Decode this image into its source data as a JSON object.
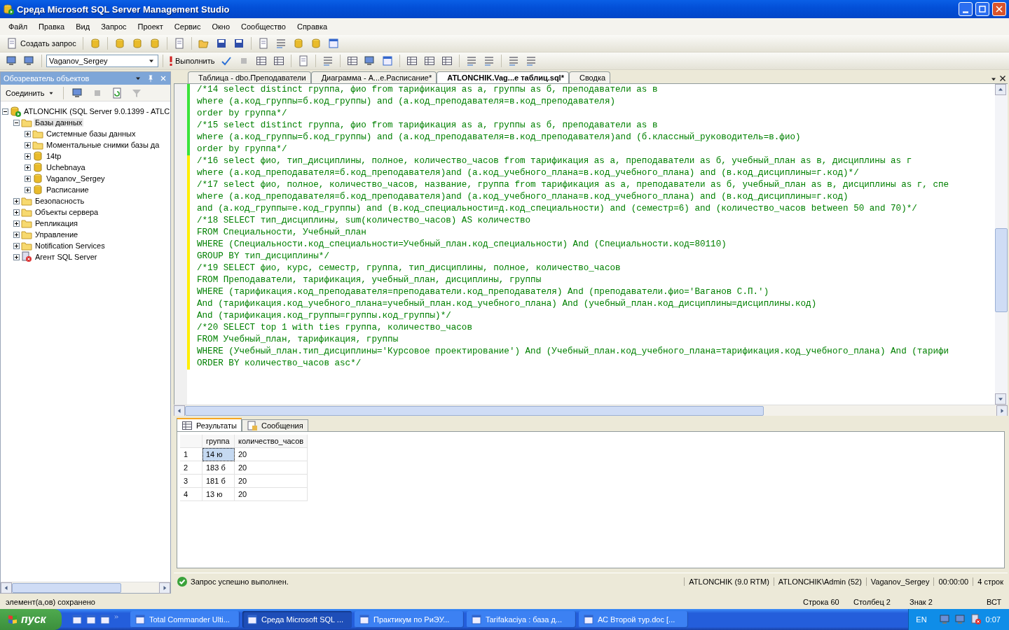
{
  "window": {
    "title": "Среда Microsoft SQL Server Management Studio"
  },
  "menu": [
    "Файл",
    "Правка",
    "Вид",
    "Запрос",
    "Проект",
    "Сервис",
    "Окно",
    "Сообщество",
    "Справка"
  ],
  "toolbar": {
    "new_query": "Создать запрос",
    "database": "Vaganov_Sergey",
    "execute": "Выполнить"
  },
  "object_explorer": {
    "title": "Обозреватель объектов",
    "connect": "Соединить",
    "tree": [
      {
        "label": "ATLONCHIK (SQL Server 9.0.1399 - ATLC",
        "kind": "server",
        "expanded": true,
        "selected": false,
        "children": [
          {
            "label": "Базы данных",
            "kind": "folder",
            "expanded": true,
            "selected": true,
            "children": [
              {
                "label": "Системные базы данных",
                "kind": "folder",
                "expanded": false,
                "selected": false
              },
              {
                "label": "Моментальные снимки базы да",
                "kind": "folder",
                "expanded": false,
                "selected": false
              },
              {
                "label": "14tp",
                "kind": "database",
                "expanded": false,
                "selected": false
              },
              {
                "label": "Uchebnaya",
                "kind": "database",
                "expanded": false,
                "selected": false
              },
              {
                "label": "Vaganov_Sergey",
                "kind": "database",
                "expanded": false,
                "selected": false
              },
              {
                "label": "Расписание",
                "kind": "database",
                "expanded": false,
                "selected": false
              }
            ]
          },
          {
            "label": "Безопасность",
            "kind": "folder",
            "expanded": false,
            "selected": false
          },
          {
            "label": "Объекты сервера",
            "kind": "folder",
            "expanded": false,
            "selected": false
          },
          {
            "label": "Репликация",
            "kind": "folder",
            "expanded": false,
            "selected": false
          },
          {
            "label": "Управление",
            "kind": "folder",
            "expanded": false,
            "selected": false
          },
          {
            "label": "Notification Services",
            "kind": "folder",
            "expanded": false,
            "selected": false
          },
          {
            "label": "Агент SQL Server",
            "kind": "agent",
            "expanded": false,
            "selected": false
          }
        ]
      }
    ]
  },
  "document_tabs": [
    {
      "label": "Таблица - dbo.Преподаватели",
      "selected": false
    },
    {
      "label": "Диаграмма - A...е.Расписание*",
      "selected": false
    },
    {
      "label": "ATLONCHIK.Vag...е таблиц.sql*",
      "selected": true
    },
    {
      "label": "Сводка",
      "selected": false
    }
  ],
  "editor": {
    "lines": [
      {
        "text": "/*14 select distinct группа, фио from тарификация as a, группы as б, преподаватели as в",
        "changed": false
      },
      {
        "text": "where (a.код_группы=б.код_группы) and (a.код_преподавателя=в.код_преподавателя)",
        "changed": false
      },
      {
        "text": "order by группа*/",
        "changed": false
      },
      {
        "text": "/*15 select distinct группа, фио from тарификация as a, группы as б, преподаватели as в",
        "changed": false
      },
      {
        "text": "where (a.код_группы=б.код_группы) and (a.код_преподавателя=в.код_преподавателя)and (б.классный_руководитель=в.фио)",
        "changed": false
      },
      {
        "text": "order by группа*/",
        "changed": false
      },
      {
        "text": "/*16 select фио, тип_дисциплины, полное, количество_часов from тарификация as a, преподаватели as б, учебный_план as в, дисциплины as г",
        "changed": true
      },
      {
        "text": "where (a.код_преподавателя=б.код_преподавателя)and (a.код_учебного_плана=в.код_учебного_плана) and (в.код_дисциплины=г.код)*/",
        "changed": true
      },
      {
        "text": "/*17 select фио, полное, количество_часов, название, группа from тарификация as a, преподаватели as б, учебный_план as в, дисциплины as г, спе",
        "changed": true
      },
      {
        "text": "where (a.код_преподавателя=б.код_преподавателя)and (a.код_учебного_плана=в.код_учебного_плана) and (в.код_дисциплины=г.код)",
        "changed": true
      },
      {
        "text": "and (a.код_группы=е.код_группы) and (в.код_специальности=д.код_специальности) and (семестр=6) and (количество_часов between 50 and 70)*/",
        "changed": true
      },
      {
        "text": "/*18 SELECT тип_дисциплины, sum(количество_часов) AS количество",
        "changed": true
      },
      {
        "text": "FROM Специальности, Учебный_план",
        "changed": true
      },
      {
        "text": "WHERE (Специальности.код_специальности=Учебный_план.код_специальности) And (Специальности.код=80110)",
        "changed": true
      },
      {
        "text": "GROUP BY тип_дисциплины*/",
        "changed": true
      },
      {
        "text": "/*19 SELECT фио, курс, семестр, группа, тип_дисциплины, полное, количество_часов",
        "changed": true
      },
      {
        "text": "FROM Преподаватели, тарификация, учебный_план, дисциплины, группы",
        "changed": true
      },
      {
        "text": "WHERE (тарификация.код_преподавателя=преподаватели.код_преподавателя) And (преподаватели.фио='Ваганов С.П.')",
        "changed": true
      },
      {
        "text": "And (тарификация.код_учебного_плана=учебный_план.код_учебного_плана) And (учебный_план.код_дисциплины=дисциплины.код)",
        "changed": true
      },
      {
        "text": "And (тарификация.код_группы=группы.код_группы)*/",
        "changed": true
      },
      {
        "text": "/*20 SELECT top 1 with ties группа, количество_часов",
        "changed": true
      },
      {
        "text": "FROM Учебный_план, тарификация, группы",
        "changed": true
      },
      {
        "text": "WHERE (Учебный_план.тип_дисциплины='Курсовое проектирование') And (Учебный_план.код_учебного_плана=тарификация.код_учебного_плана) And (тарифи",
        "changed": true
      },
      {
        "text": "ORDER BY количество_часов asc*/",
        "changed": true
      }
    ]
  },
  "results": {
    "tabs": [
      {
        "label": "Результаты",
        "kind": "grid",
        "selected": true
      },
      {
        "label": "Сообщения",
        "kind": "messages",
        "selected": false
      }
    ],
    "columns": [
      "группа",
      "количество_часов"
    ],
    "rows": [
      {
        "number": "1",
        "cells": [
          "14 ю",
          "20"
        ],
        "selected": true
      },
      {
        "number": "2",
        "cells": [
          "183 б",
          "20"
        ],
        "selected": false
      },
      {
        "number": "3",
        "cells": [
          "181 б",
          "20"
        ],
        "selected": false
      },
      {
        "number": "4",
        "cells": [
          "13 ю",
          "20"
        ],
        "selected": false
      }
    ]
  },
  "query_status": {
    "message": "Запрос успешно выполнен.",
    "fields": [
      "ATLONCHIK (9.0 RTM)",
      "ATLONCHIK\\Admin (52)",
      "Vaganov_Sergey",
      "00:00:00",
      "4 строк"
    ]
  },
  "status_bar": {
    "message": "элемент(а,ов) сохранено",
    "fields": [
      "Строка 60",
      "Столбец 2",
      "Знак 2",
      "ВСТ"
    ]
  },
  "taskbar": {
    "start": "пуск",
    "tasks": [
      {
        "label": "Total Commander Ulti...",
        "selected": false
      },
      {
        "label": "Среда Microsoft SQL ...",
        "selected": true
      },
      {
        "label": "Практикум по РиЭУ...",
        "selected": false
      },
      {
        "label": "Tarifakaciya : база д...",
        "selected": false
      },
      {
        "label": "АС Второй тур.doc [...",
        "selected": false
      }
    ],
    "language": "EN",
    "clock": "0:07"
  }
}
